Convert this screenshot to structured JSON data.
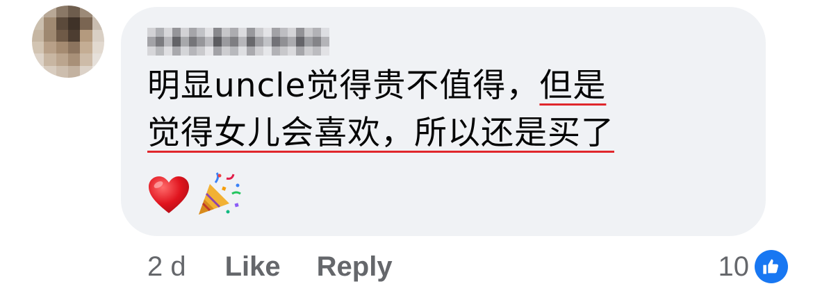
{
  "comment": {
    "author_name": "",
    "text_part1": "明显uncle觉得贵不值得，",
    "text_underlined_a": "但是",
    "text_underlined_b": "觉得女儿会喜欢，所以还是买了",
    "emojis": [
      "heart-icon",
      "party-popper-icon"
    ]
  },
  "meta": {
    "timestamp": "2 d",
    "like_label": "Like",
    "reply_label": "Reply"
  },
  "reactions": {
    "count": "10",
    "icon": "thumbs-up-icon"
  },
  "colors": {
    "bubble": "#f0f2f5",
    "meta_text": "#65676b",
    "like_blue": "#1877f2",
    "underline_red": "#e0262b"
  }
}
